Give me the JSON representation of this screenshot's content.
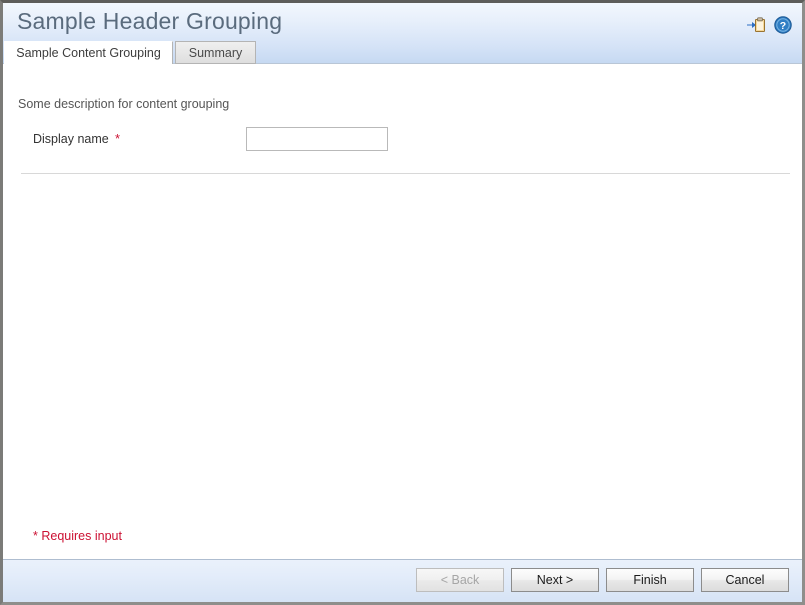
{
  "window": {
    "title": "Sample Header Grouping"
  },
  "header": {
    "icons": [
      {
        "name": "paste-clipboard-icon",
        "glyph": "clipboard"
      },
      {
        "name": "help-icon",
        "glyph": "question-circle"
      }
    ],
    "accent_color": "#5a6b7d",
    "gradient_top": "#f2f7fd",
    "gradient_bottom": "#c6d9f2"
  },
  "tabs": [
    {
      "label": "Sample Content Grouping",
      "active": true
    },
    {
      "label": "Summary",
      "active": false
    }
  ],
  "content": {
    "description": "Some description for content grouping",
    "fields": [
      {
        "label": "Display name",
        "required_marker": "*",
        "value": "",
        "placeholder": ""
      }
    ],
    "requires_input_note": "* Requires input",
    "required_color": "#cc1133"
  },
  "footer": {
    "buttons": [
      {
        "label": "< Back",
        "enabled": false
      },
      {
        "label": "Next >",
        "enabled": true
      },
      {
        "label": "Finish",
        "enabled": true
      },
      {
        "label": "Cancel",
        "enabled": true
      }
    ]
  }
}
